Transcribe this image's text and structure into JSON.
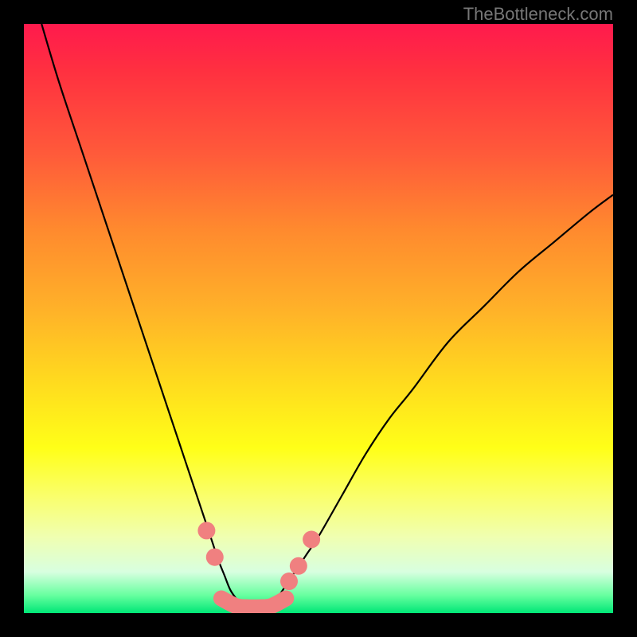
{
  "attribution": "TheBottleneck.com",
  "chart_data": {
    "type": "line",
    "title": "",
    "xlabel": "",
    "ylabel": "",
    "xlim": [
      0,
      100
    ],
    "ylim": [
      0,
      100
    ],
    "grid": false,
    "series": [
      {
        "name": "left-curve",
        "color": "#000000",
        "width": 2.2,
        "x": [
          3,
          6,
          10,
          14,
          18,
          20,
          22,
          24,
          26,
          27,
          28,
          29,
          30,
          31,
          32,
          33,
          34,
          35,
          36
        ],
        "y": [
          100,
          90,
          78,
          66,
          54,
          48,
          42,
          36,
          30,
          27,
          24,
          21,
          18,
          15,
          12,
          9,
          6.5,
          4,
          2.5
        ]
      },
      {
        "name": "right-curve",
        "color": "#000000",
        "width": 2.2,
        "x": [
          43,
          44,
          46,
          48,
          50,
          54,
          58,
          62,
          66,
          72,
          78,
          84,
          90,
          96,
          100
        ],
        "y": [
          2.5,
          4,
          7,
          10,
          13,
          20,
          27,
          33,
          38,
          46,
          52,
          58,
          63,
          68,
          71
        ]
      },
      {
        "name": "valley-floor",
        "color": "#f08080",
        "width": 20,
        "linecap": "round",
        "x": [
          33.5,
          36,
          38,
          40,
          42,
          44.5
        ],
        "y": [
          2.5,
          1.2,
          1.0,
          1.0,
          1.2,
          2.5
        ]
      },
      {
        "name": "left-tick-1",
        "type": "marker",
        "color": "#f08080",
        "radius": 11,
        "x": [
          31.0
        ],
        "y": [
          14.0
        ]
      },
      {
        "name": "left-tick-2",
        "type": "marker",
        "color": "#f08080",
        "radius": 11,
        "x": [
          32.4
        ],
        "y": [
          9.5
        ]
      },
      {
        "name": "right-tick-1",
        "type": "marker",
        "color": "#f08080",
        "radius": 11,
        "x": [
          45.0
        ],
        "y": [
          5.4
        ]
      },
      {
        "name": "right-tick-2",
        "type": "marker",
        "color": "#f08080",
        "radius": 11,
        "x": [
          46.6
        ],
        "y": [
          8.0
        ]
      },
      {
        "name": "right-tick-3",
        "type": "marker",
        "color": "#f08080",
        "radius": 11,
        "x": [
          48.8
        ],
        "y": [
          12.5
        ]
      }
    ]
  }
}
